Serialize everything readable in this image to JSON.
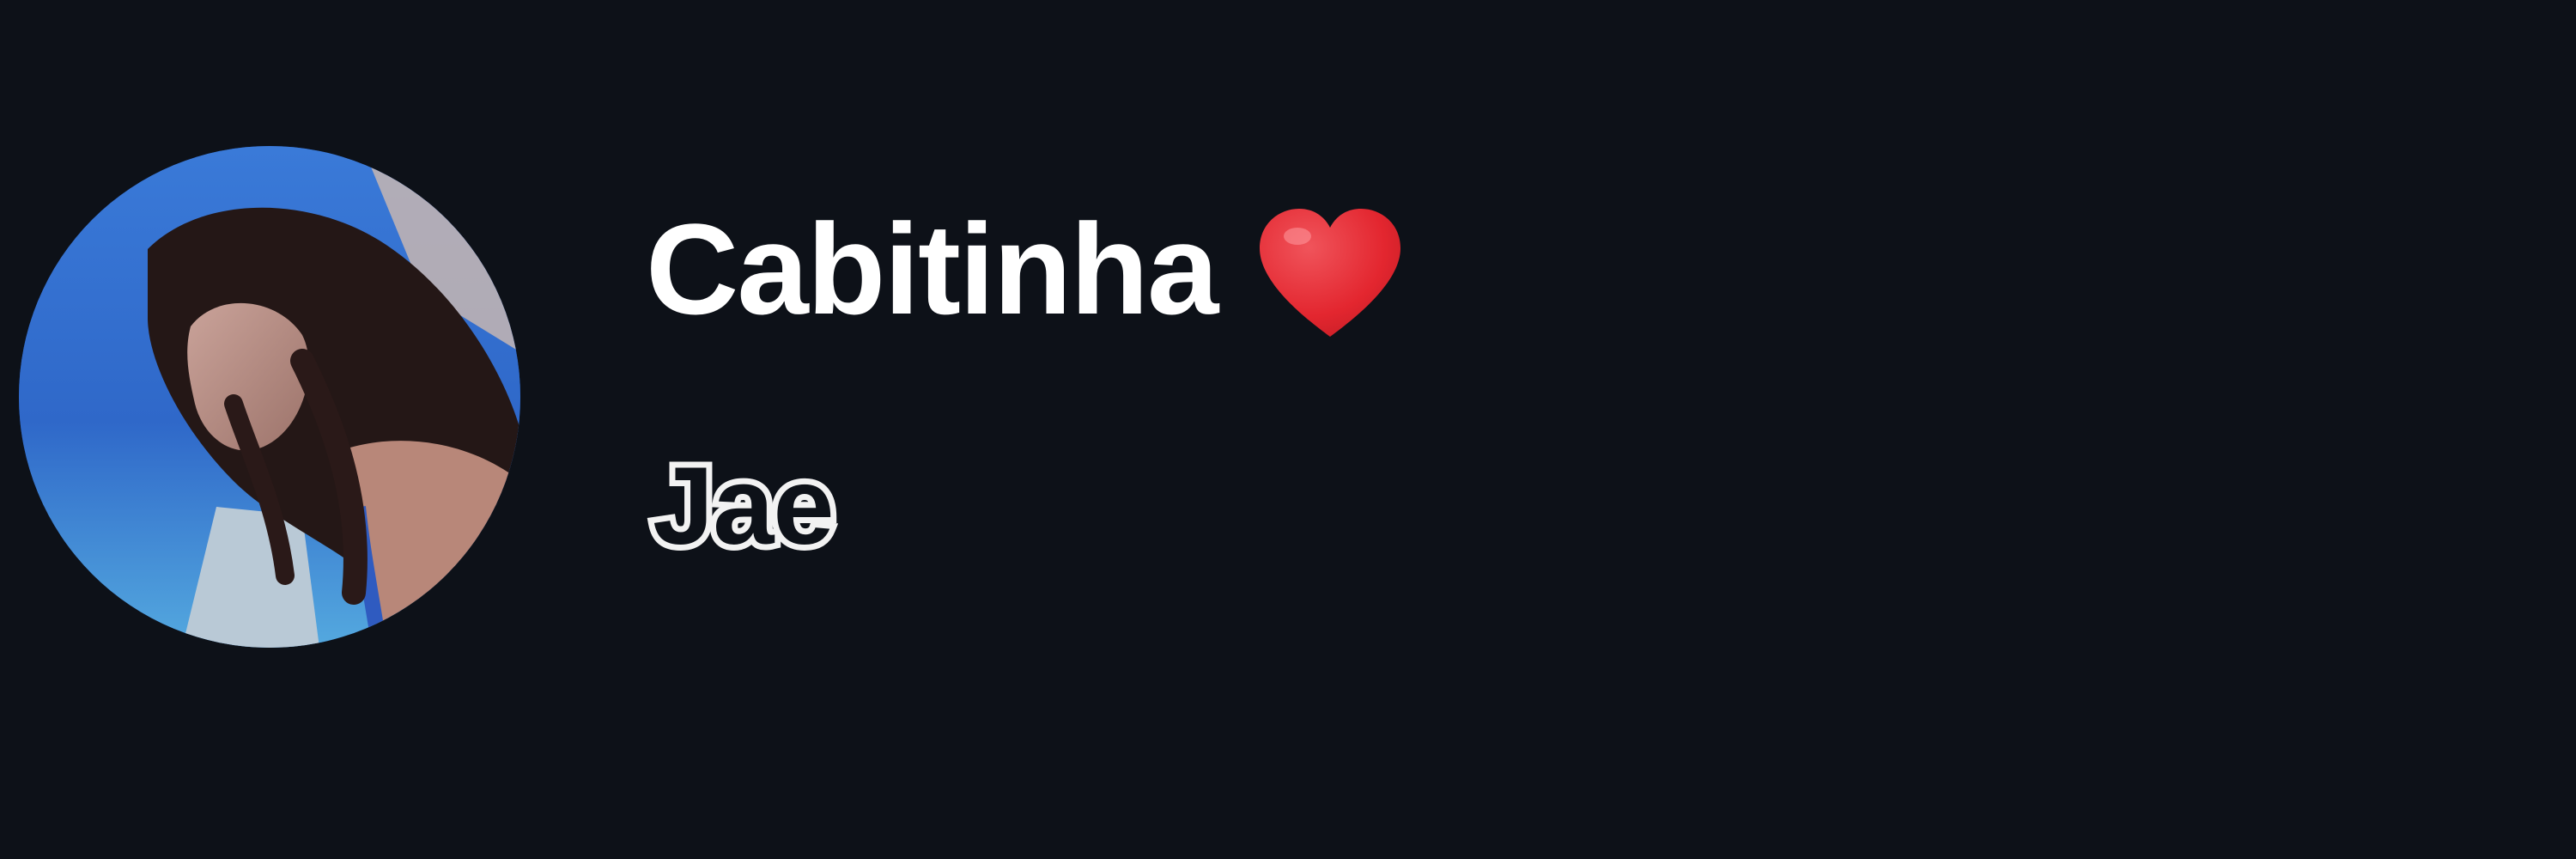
{
  "profile": {
    "display_name": "Cabitinha",
    "name_emoji": "heart-icon",
    "sub_name": "Jae",
    "avatar": "avatar"
  },
  "colors": {
    "background": "#0d1118",
    "name_text": "#ffffff",
    "heart": "#e3262f",
    "sub_name_outline": "#f2f2f2"
  }
}
